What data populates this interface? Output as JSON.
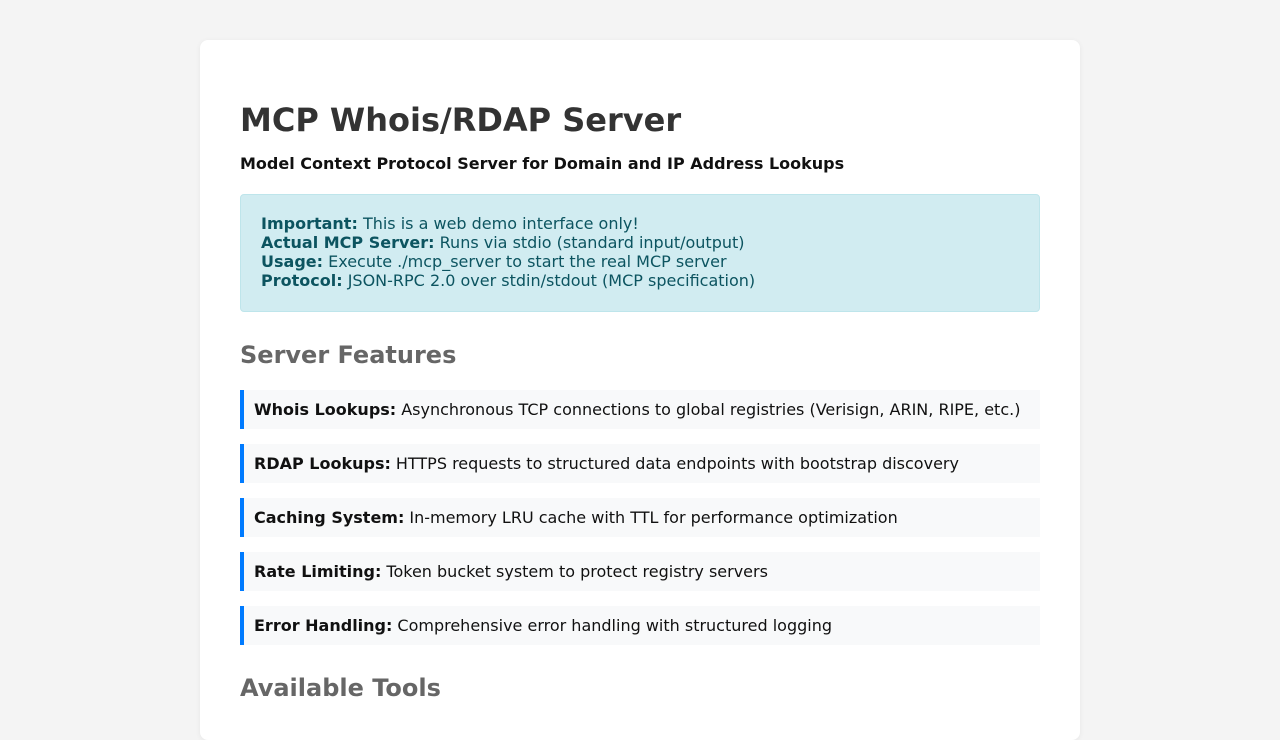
{
  "header": {
    "title": "MCP Whois/RDAP Server",
    "subtitle": "Model Context Protocol Server for Domain and IP Address Lookups"
  },
  "notice": {
    "lines": [
      {
        "label": "Important:",
        "text": "This is a web demo interface only!"
      },
      {
        "label": "Actual MCP Server:",
        "text": "Runs via stdio (standard input/output)"
      },
      {
        "label": "Usage:",
        "text": "Execute ./mcp_server to start the real MCP server"
      },
      {
        "label": "Protocol:",
        "text": "JSON-RPC 2.0 over stdin/stdout (MCP specification)"
      }
    ]
  },
  "features": {
    "heading": "Server Features",
    "items": [
      {
        "label": "Whois Lookups:",
        "text": "Asynchronous TCP connections to global registries (Verisign, ARIN, RIPE, etc.)"
      },
      {
        "label": "RDAP Lookups:",
        "text": "HTTPS requests to structured data endpoints with bootstrap discovery"
      },
      {
        "label": "Caching System:",
        "text": "In-memory LRU cache with TTL for performance optimization"
      },
      {
        "label": "Rate Limiting:",
        "text": "Token bucket system to protect registry servers"
      },
      {
        "label": "Error Handling:",
        "text": "Comprehensive error handling with structured logging"
      }
    ]
  },
  "tools": {
    "heading": "Available Tools"
  },
  "colors": {
    "accent": "#007bff",
    "notice_bg": "#d1ecf1",
    "notice_text": "#0c5460"
  }
}
